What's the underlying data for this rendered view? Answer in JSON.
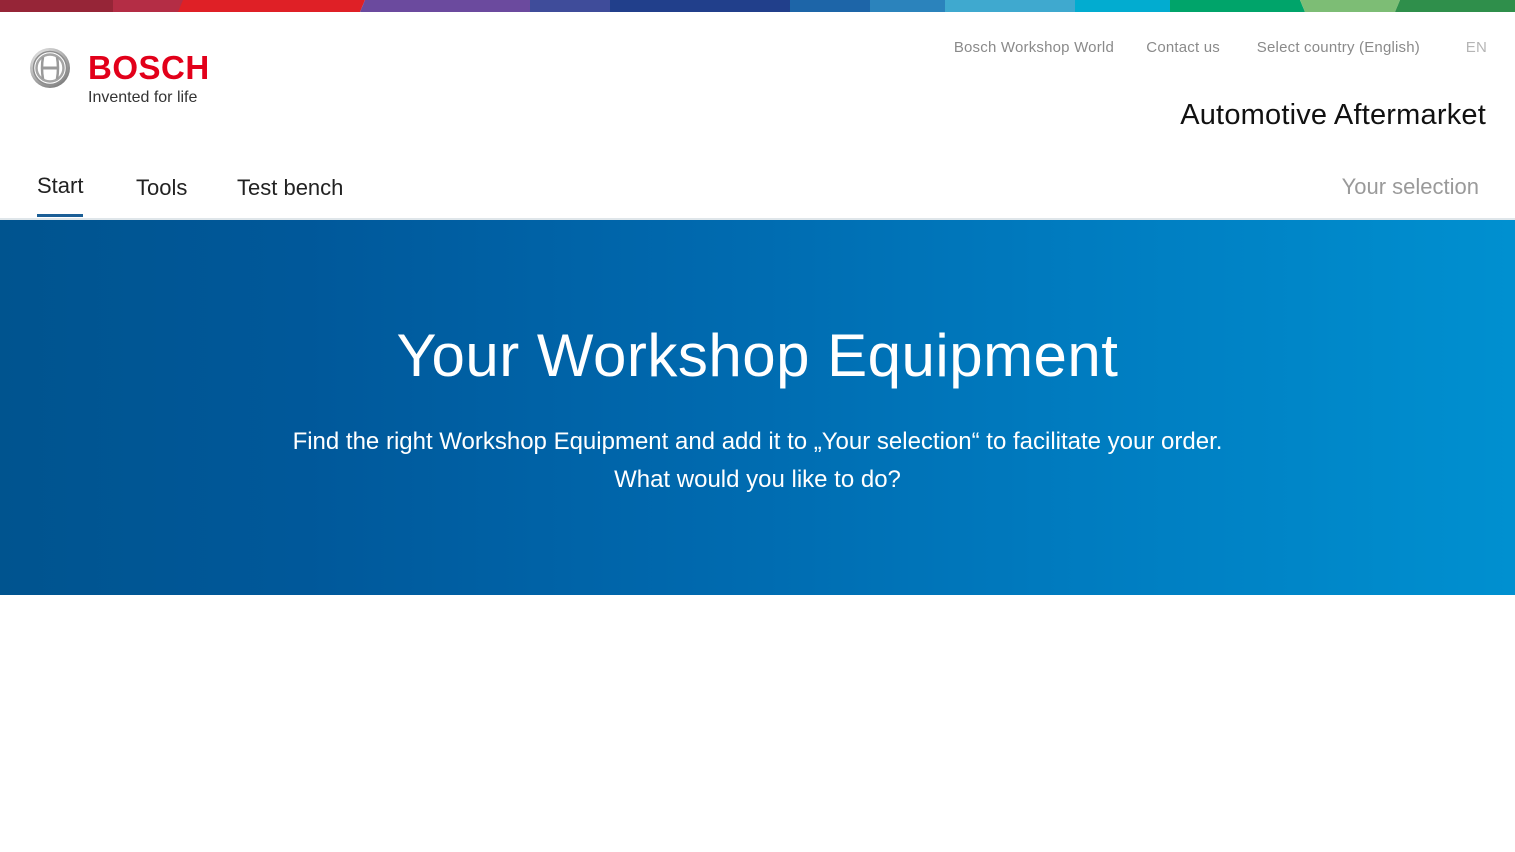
{
  "colors": {
    "brand_red": "#e2001a",
    "hero_start": "#00548f",
    "hero_end": "#0090d0",
    "active_tab_underline": "#1b5e96",
    "colorbar": [
      "#962537",
      "#b42d45",
      "#df2026",
      "#6b4a9e",
      "#3f4c9a",
      "#213f8b",
      "#1d65a8",
      "#2b83bc",
      "#3fa9cf",
      "#02acd0",
      "#00a46a",
      "#7dbd75",
      "#2f8f4b"
    ]
  },
  "header": {
    "logo": {
      "wordmark": "BOSCH",
      "tagline": "Invented for life",
      "emblem_icon": "bosch-armature-icon"
    },
    "meta_nav": [
      {
        "label": "Bosch Workshop World"
      },
      {
        "label": "Contact us"
      },
      {
        "label": "Select country (English)"
      },
      {
        "label": "EN"
      }
    ],
    "brand_title": "Automotive Aftermarket"
  },
  "main_nav": {
    "tabs": [
      {
        "label": "Start",
        "active": true
      },
      {
        "label": "Tools",
        "active": false
      },
      {
        "label": "Test bench",
        "active": false
      }
    ],
    "your_selection": "Your selection"
  },
  "hero": {
    "title": "Your Workshop Equipment",
    "lead_line1": "Find the right Workshop Equipment and add it to „Your selection“ to facilitate your order.",
    "lead_line2": "What would you like to do?"
  }
}
